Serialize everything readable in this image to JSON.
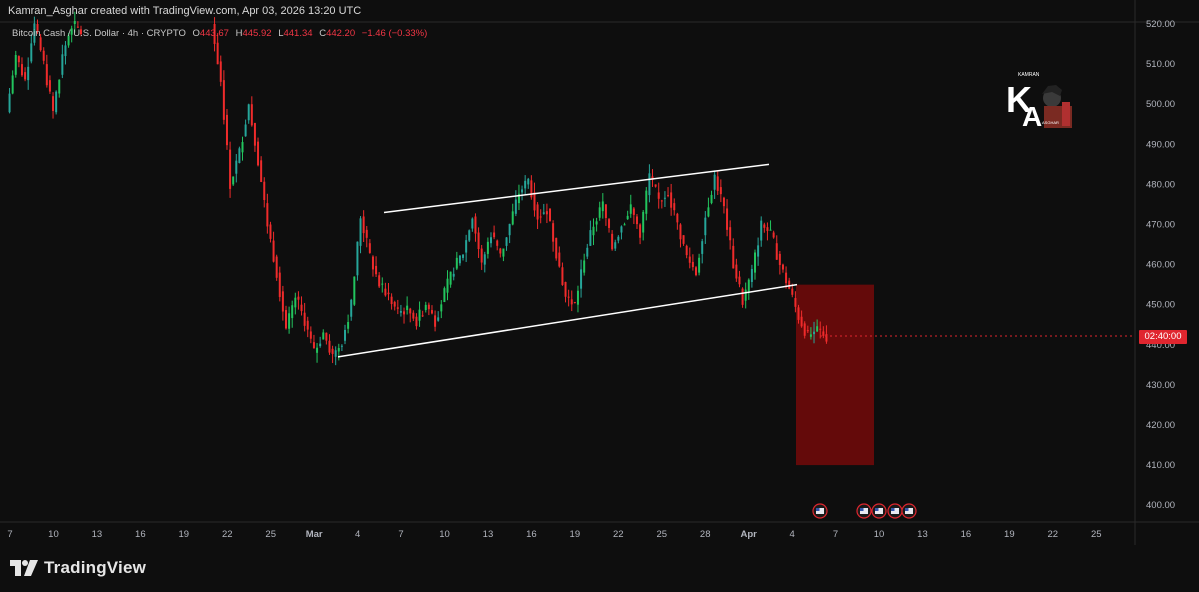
{
  "header": {
    "attribution": "Kamran_Asghar created with TradingView.com, Apr 03, 2026 13:20 UTC"
  },
  "symbol": {
    "name": "Bitcoin Cash / U.S. Dollar · 4h · CRYPTO",
    "open_label": "O",
    "open": "443.67",
    "high_label": "H",
    "high": "445.92",
    "low_label": "L",
    "low": "441.34",
    "close_label": "C",
    "close": "442.20",
    "change": "−1.46 (−0.33%)"
  },
  "price_label": {
    "text": "02:40:00",
    "color": "#e0262f"
  },
  "footer": {
    "brand": "TradingView"
  },
  "logo": {
    "icon": "ka-avatar-logo",
    "text": "KAMRAN",
    "subtext": "ASGHAR"
  },
  "colors": {
    "up": "#26a69a",
    "up_bright": "#22c55e",
    "down": "#ef2b2b",
    "target_box": "#6b0a0a",
    "channel": "#ffffff",
    "axis_text": "#b2b5be"
  },
  "chart_data": {
    "type": "candlestick",
    "title": "Bitcoin Cash / U.S. Dollar · 4h · CRYPTO",
    "ylim": [
      397,
      522
    ],
    "y_ticks": [
      "520.00",
      "510.00",
      "500.00",
      "490.00",
      "480.00",
      "470.00",
      "460.00",
      "450.00",
      "440.00",
      "430.00",
      "420.00",
      "410.00",
      "400.00"
    ],
    "x_ticks": [
      "7",
      "10",
      "13",
      "16",
      "19",
      "22",
      "25",
      "Mar",
      "4",
      "7",
      "10",
      "13",
      "16",
      "19",
      "22",
      "25",
      "28",
      "Apr",
      "4",
      "7",
      "10",
      "13",
      "16",
      "19",
      "22",
      "25"
    ],
    "current_price": 442.2,
    "price_path": [
      [
        0,
        498
      ],
      [
        1,
        512
      ],
      [
        2,
        506
      ],
      [
        3,
        520
      ],
      [
        4,
        510
      ],
      [
        5,
        498
      ],
      [
        6,
        512
      ],
      [
        7,
        520
      ],
      [
        8,
        518
      ],
      [
        22,
        520
      ],
      [
        23,
        506
      ],
      [
        24,
        480
      ],
      [
        25,
        488
      ],
      [
        26,
        500
      ],
      [
        27,
        486
      ],
      [
        28,
        470
      ],
      [
        29,
        458
      ],
      [
        30,
        444
      ],
      [
        31,
        452
      ],
      [
        32,
        446
      ],
      [
        33,
        438
      ],
      [
        34,
        443
      ],
      [
        35,
        437
      ],
      [
        36,
        441
      ],
      [
        37,
        450
      ],
      [
        38,
        472
      ],
      [
        39,
        462
      ],
      [
        40,
        455
      ],
      [
        41,
        452
      ],
      [
        42,
        448
      ],
      [
        43,
        449
      ],
      [
        44,
        446
      ],
      [
        45,
        450
      ],
      [
        46,
        446
      ],
      [
        47,
        453
      ],
      [
        48,
        459
      ],
      [
        49,
        463
      ],
      [
        50,
        472
      ],
      [
        51,
        460
      ],
      [
        52,
        468
      ],
      [
        53,
        462
      ],
      [
        54,
        470
      ],
      [
        55,
        478
      ],
      [
        56,
        481
      ],
      [
        57,
        472
      ],
      [
        58,
        474
      ],
      [
        59,
        463
      ],
      [
        60,
        452
      ],
      [
        61,
        450
      ],
      [
        62,
        462
      ],
      [
        63,
        470
      ],
      [
        64,
        475
      ],
      [
        65,
        464
      ],
      [
        66,
        470
      ],
      [
        67,
        474
      ],
      [
        68,
        468
      ],
      [
        69,
        482
      ],
      [
        70,
        476
      ],
      [
        71,
        478
      ],
      [
        72,
        470
      ],
      [
        73,
        462
      ],
      [
        74,
        458
      ],
      [
        75,
        472
      ],
      [
        76,
        482
      ],
      [
        77,
        474
      ],
      [
        78,
        460
      ],
      [
        79,
        451
      ],
      [
        80,
        458
      ],
      [
        81,
        470
      ],
      [
        82,
        468
      ],
      [
        83,
        460
      ],
      [
        84,
        454
      ],
      [
        85,
        447
      ],
      [
        86,
        442
      ],
      [
        87,
        444
      ],
      [
        88,
        442
      ]
    ],
    "channel": {
      "upper": [
        [
          "Mar 5",
          473
        ],
        [
          "Mar 30",
          485
        ]
      ],
      "lower": [
        [
          "Mar 1",
          437
        ],
        [
          "Apr 1",
          455
        ]
      ]
    },
    "target_zone": {
      "from_price": 455,
      "to_price": 410,
      "x_start": "Apr 1",
      "x_end": "Apr 7"
    },
    "event_markers": [
      {
        "x": "Apr 3",
        "icon": "us-flag-icon"
      },
      {
        "x": "Apr 5",
        "icon": "us-flag-icon"
      },
      {
        "x": "Apr 6",
        "icon": "us-flag-icon"
      },
      {
        "x": "Apr 7",
        "icon": "us-flag-icon"
      },
      {
        "x": "Apr 8",
        "icon": "us-flag-icon"
      }
    ]
  }
}
